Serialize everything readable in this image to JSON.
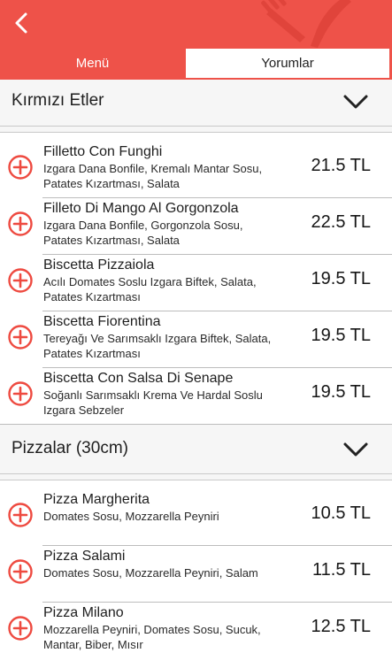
{
  "header": {
    "back_icon": "chevron-left-icon",
    "decoration_icon": "fork-knife-icon",
    "color": "#ee5249"
  },
  "tabs": [
    {
      "label": "Menü",
      "active": true
    },
    {
      "label": "Yorumlar",
      "active": false
    }
  ],
  "sections": [
    {
      "title": "Kırmızı Etler",
      "items": [
        {
          "name": "Filletto Con Funghi",
          "desc": "Izgara Dana Bonfile, Kremalı Mantar Sosu, Patates Kızartması, Salata",
          "price": "21.5 TL"
        },
        {
          "name": "Filleto Di Mango Al Gorgonzola",
          "desc": "Izgara Dana Bonfile, Gorgonzola Sosu, Patates Kızartması, Salata",
          "price": "22.5 TL"
        },
        {
          "name": "Biscetta Pizzaiola",
          "desc": "Acılı Domates Soslu Izgara Biftek, Salata, Patates Kızartması",
          "price": "19.5 TL"
        },
        {
          "name": "Biscetta Fiorentina",
          "desc": "Tereyağı Ve Sarımsaklı Izgara Biftek, Salata, Patates Kızartması",
          "price": "19.5 TL"
        },
        {
          "name": "Biscetta Con Salsa Di Senape",
          "desc": "Soğanlı Sarımsaklı Krema Ve Hardal Soslu Izgara Sebzeler",
          "price": "19.5 TL"
        }
      ]
    },
    {
      "title": "Pizzalar (30cm)",
      "items": [
        {
          "name": "Pizza Margherita",
          "desc": "Domates Sosu, Mozzarella Peyniri",
          "price": "10.5 TL"
        },
        {
          "name": "Pizza Salami",
          "desc": "Domates Sosu, Mozzarella Peyniri, Salam",
          "price": "11.5 TL"
        },
        {
          "name": "Pizza Milano",
          "desc": "Mozzarella Peyniri, Domates Sosu, Sucuk, Mantar, Biber, Mısır",
          "price": "12.5 TL"
        }
      ]
    }
  ]
}
